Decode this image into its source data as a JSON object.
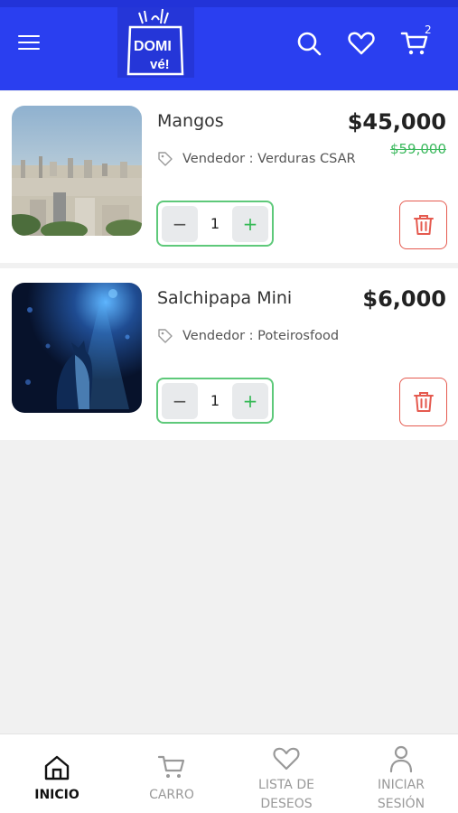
{
  "header": {
    "menu_icon": "hamburger-icon",
    "logo": {
      "line1": "DOMI",
      "line2": "vé!"
    },
    "search_icon": "search-icon",
    "wishlist_icon": "heart-icon",
    "cart_icon": "cart-icon",
    "cart_count": "2"
  },
  "cart": {
    "items": [
      {
        "name": "Mangos",
        "vendor": "Vendedor : Verduras CSAR",
        "price": "$45,000",
        "old_price": "$59,000",
        "quantity": "1",
        "decrement": "−",
        "increment": "+"
      },
      {
        "name": "Salchipapa Mini",
        "vendor": "Vendedor : Poteirosfood",
        "price": "$6,000",
        "quantity": "1",
        "decrement": "−",
        "increment": "+"
      }
    ]
  },
  "nav": {
    "items": [
      {
        "label": "INICIO",
        "icon": "home-icon",
        "active": true
      },
      {
        "label": "CARRO",
        "icon": "cart-icon"
      },
      {
        "label_line1": "LISTA DE",
        "label_line2": "DESEOS",
        "icon": "heart-icon"
      },
      {
        "label_line1": "INICIAR",
        "label_line2": "SESIÓN",
        "icon": "user-icon"
      }
    ]
  },
  "colors": {
    "header": "#2a3ff0",
    "accent_green": "#3cb95e",
    "delete_red": "#e55a4f"
  }
}
